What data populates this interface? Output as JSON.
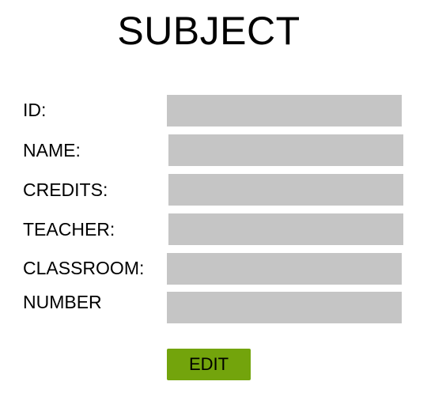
{
  "title": "SUBJECT",
  "form": {
    "fields": [
      {
        "label": "ID:",
        "value": ""
      },
      {
        "label": "NAME:",
        "value": ""
      },
      {
        "label": "CREDITS:",
        "value": ""
      },
      {
        "label": "TEACHER:",
        "value": ""
      },
      {
        "label": "CLASSROOM:",
        "value": ""
      },
      {
        "label": "NUMBER",
        "value": ""
      }
    ],
    "edit_label": "EDIT"
  },
  "colors": {
    "field_background": "#c5c5c5",
    "button_background": "#73a40c"
  }
}
